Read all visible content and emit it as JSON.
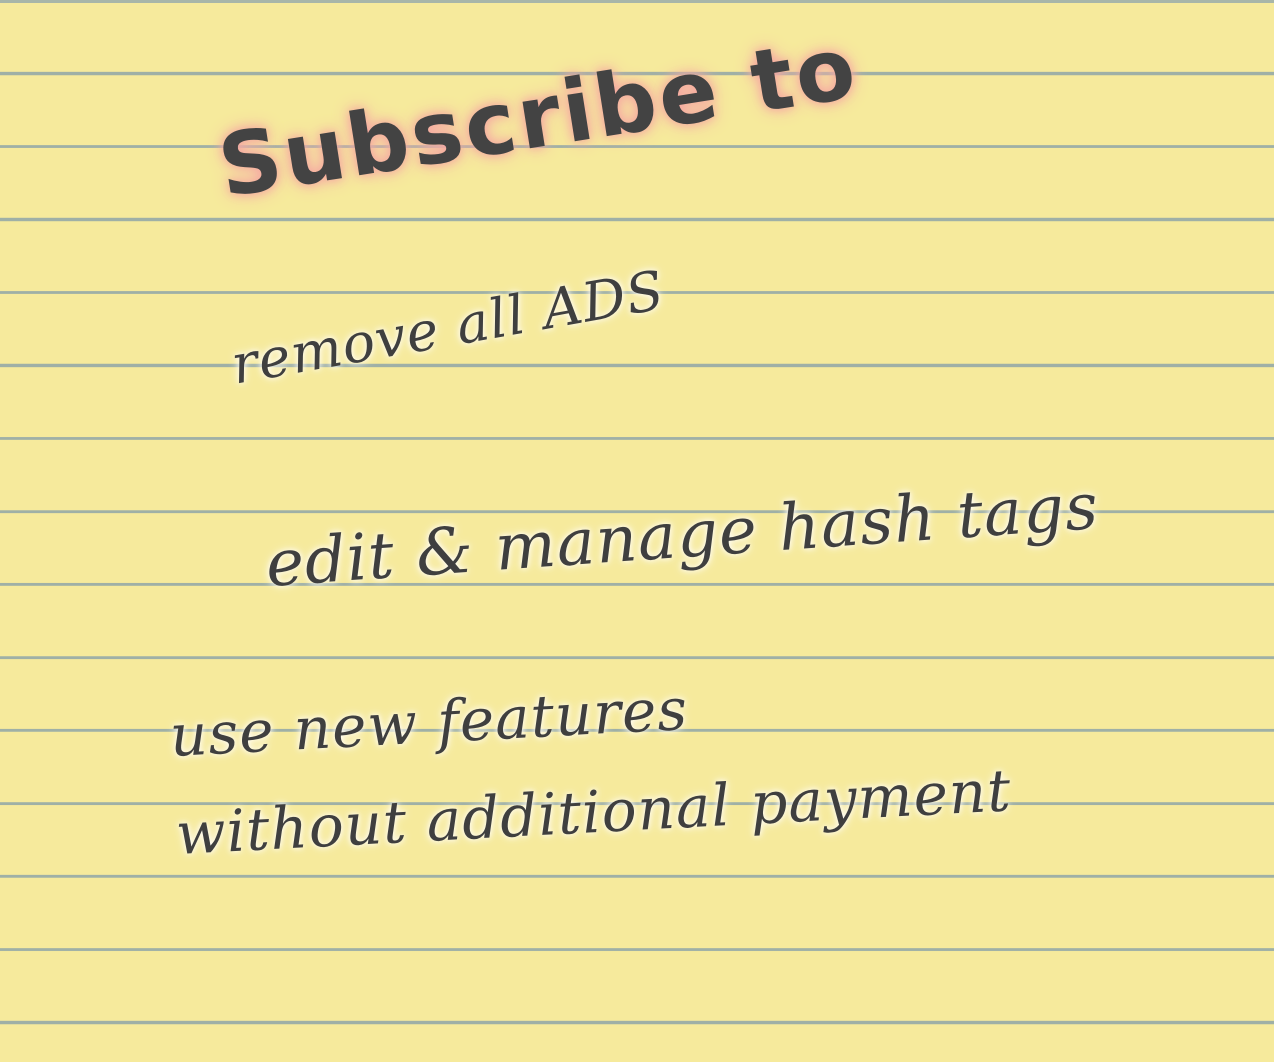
{
  "title": "Subscribe to",
  "benefits": [
    "remove all ADS",
    "edit & manage hash tags",
    "use new features",
    "without additional payment"
  ]
}
